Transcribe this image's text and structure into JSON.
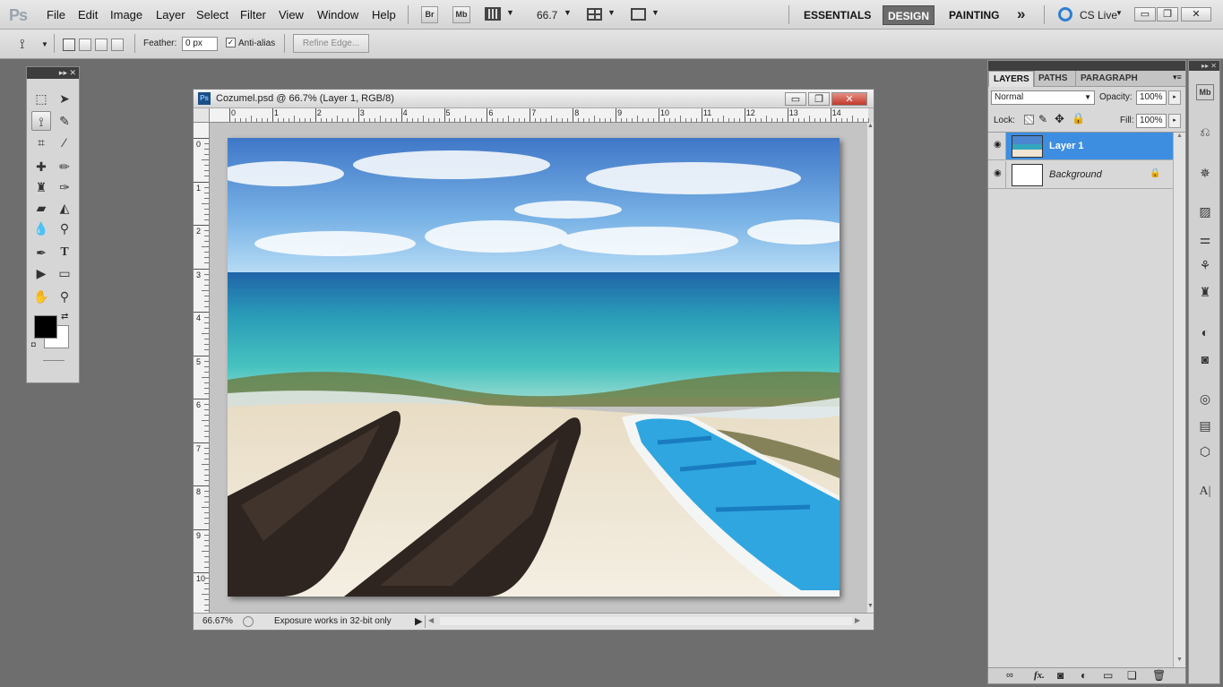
{
  "app": {
    "logo": "Ps"
  },
  "menu": [
    "File",
    "Edit",
    "Image",
    "Layer",
    "Select",
    "Filter",
    "View",
    "Window",
    "Help"
  ],
  "appbar": {
    "bridge": "Br",
    "minibridge": "Mb",
    "zoom": "66.7"
  },
  "workspaces": {
    "essentials": "ESSENTIALS",
    "design": "DESIGN",
    "painting": "PAINTING",
    "more": "»"
  },
  "cslive": "CS Live",
  "window_controls": {
    "minimize": "▭",
    "restore": "❐",
    "close": "✕"
  },
  "options": {
    "feather_label": "Feather:",
    "feather_value": "0 px",
    "antialias_label": "Anti-alias",
    "antialias_checked": true,
    "refine_edge": "Refine Edge..."
  },
  "document": {
    "title": "Cozumel.psd @ 66.7% (Layer 1, RGB/8)",
    "ruler_h": [
      "0",
      "1",
      "2",
      "3",
      "4",
      "5",
      "6",
      "7",
      "8",
      "9",
      "10",
      "11",
      "12",
      "13",
      "14"
    ],
    "ruler_v": [
      "0",
      "1",
      "2",
      "3",
      "4",
      "5",
      "6",
      "7",
      "8",
      "9",
      "10"
    ],
    "zoom_status": "66.67%",
    "status_text": "Exposure works in 32-bit only"
  },
  "layers_panel": {
    "tabs": [
      "LAYERS",
      "PATHS",
      "PARAGRAPH"
    ],
    "blend_mode": "Normal",
    "opacity_label": "Opacity:",
    "opacity_value": "100%",
    "lock_label": "Lock:",
    "fill_label": "Fill:",
    "fill_value": "100%",
    "layers": [
      {
        "name": "Layer 1",
        "selected": true
      },
      {
        "name": "Background",
        "selected": false,
        "locked": true
      }
    ],
    "footer_icons": [
      "link-icon",
      "fx-icon",
      "mask-icon",
      "adjustment-icon",
      "group-icon",
      "new-layer-icon",
      "trash-icon"
    ]
  },
  "colors": {
    "selection": "#3d8ee0",
    "foreground": "#000000",
    "background": "#ffffff"
  }
}
